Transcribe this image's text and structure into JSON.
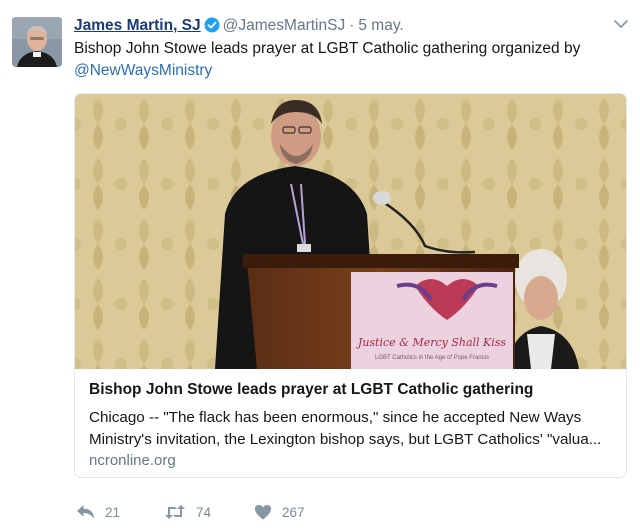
{
  "tweet": {
    "author_name": "James Martin, SJ",
    "handle": "@JamesMartinSJ",
    "separator": "·",
    "time": "5 may.",
    "text": "Bishop John Stowe leads prayer at LGBT Catholic gathering organized by",
    "mention": "@NewWaysMinistry",
    "menu_icon": "chevron-down-icon",
    "verified_icon": "verified-badge-icon"
  },
  "card": {
    "image_description_icon": "photo",
    "banner_line1": "Justice & Mercy Shall Kiss",
    "banner_line2": "LGBT Catholics in the Age of Pope Francis",
    "title": "Bishop John Stowe leads prayer at LGBT Catholic gathering",
    "description": "Chicago -- \"The flack has been enormous,\" since he accepted New Ways Ministry's invitation, the Lexington bishop says, but LGBT Catholics' \"valua...",
    "domain": "ncronline.org"
  },
  "actions": {
    "reply_count": "21",
    "retweet_count": "74",
    "like_count": "267",
    "reply_icon": "reply-icon",
    "retweet_icon": "retweet-icon",
    "like_icon": "heart-icon"
  },
  "colors": {
    "link": "#2b6cb3",
    "name": "#1a3a7a",
    "muted": "#657786",
    "verified": "#1da1f2"
  }
}
